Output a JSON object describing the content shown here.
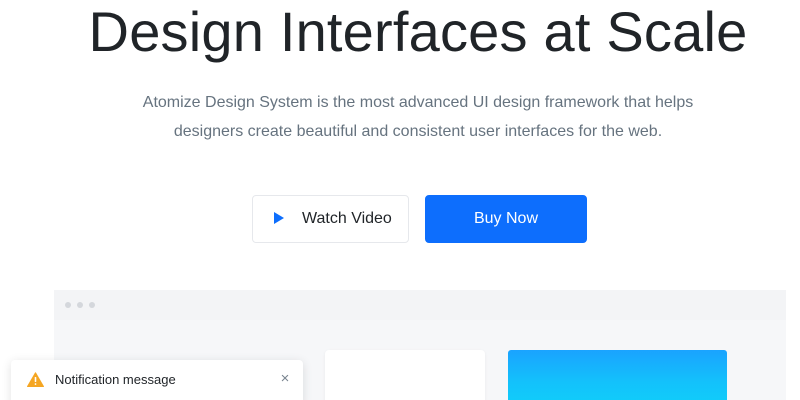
{
  "hero": {
    "title": "Design Interfaces at Scale",
    "description_line1": "Atomize Design System is the most advanced UI design framework that helps",
    "description_line2": "designers create beautiful and consistent user interfaces for the web."
  },
  "actions": {
    "watch_video_label": "Watch Video",
    "buy_now_label": "Buy Now",
    "watch_video_icon": "play-icon"
  },
  "notification": {
    "message": "Notification message",
    "close_glyph": "×",
    "icon": "warning-icon"
  },
  "colors": {
    "primary": "#0d6efd",
    "title": "#202428",
    "muted_text": "#66737f",
    "warning": "#f5a623",
    "preview_gradient_top": "#1aa3ff",
    "preview_gradient_bottom": "#10d0fa"
  }
}
